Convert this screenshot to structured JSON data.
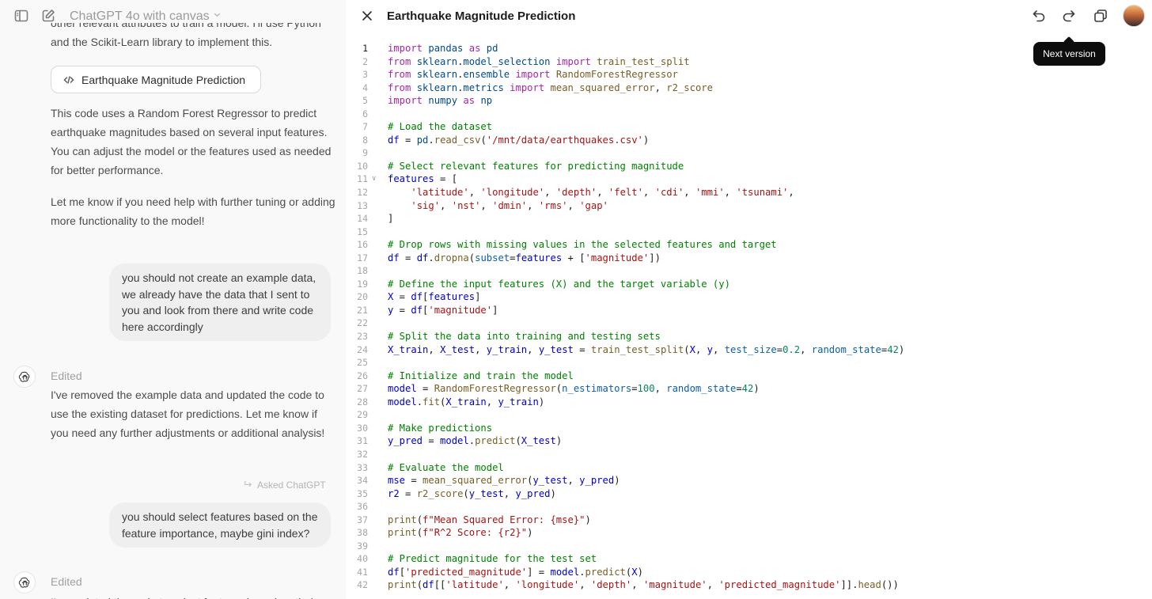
{
  "header": {
    "model_title": "ChatGPT 4o with canvas"
  },
  "chat": {
    "clipped_top_line": "other relevant attributes to train a model. I'll use Python",
    "intro_line": "and the Scikit-Learn library to implement this.",
    "canvas_chip_label": "Earthquake Magnitude Prediction",
    "assistant_msg_1": "This code uses a Random Forest Regressor to predict earthquake magnitudes based on several input features. You can adjust the model or the features used as needed for better performance.",
    "assistant_msg_2": "Let me know if you need help with further tuning or adding more functionality to the model!",
    "user_msg_1": "you should not create an example data, we already have the data that I sent to you and look from there and write code here accordingly",
    "edited_label_1": "Edited",
    "assistant_msg_3": "I've removed the example data and updated the code to use the existing dataset for predictions. Let me know if you need any further adjustments or additional analysis!",
    "asked_label": "Asked ChatGPT",
    "user_msg_2": "you should select features based on the feature importance, maybe gini index?",
    "edited_label_2": "Edited",
    "clipped_bottom_line": "I've updated the code to select features based on their"
  },
  "canvas": {
    "title": "Earthquake Magnitude Prediction",
    "tooltip": "Next version",
    "icons": {
      "close": "close-icon",
      "undo": "undo-icon",
      "redo": "redo-icon",
      "copy": "copy-icon"
    },
    "active_line": 1,
    "code_lines": [
      "import pandas as pd",
      "from sklearn.model_selection import train_test_split",
      "from sklearn.ensemble import RandomForestRegressor",
      "from sklearn.metrics import mean_squared_error, r2_score",
      "import numpy as np",
      "",
      "# Load the dataset",
      "df = pd.read_csv('/mnt/data/earthquakes.csv')",
      "",
      "# Select relevant features for predicting magnitude",
      "features = [",
      "    'latitude', 'longitude', 'depth', 'felt', 'cdi', 'mmi', 'tsunami',",
      "    'sig', 'nst', 'dmin', 'rms', 'gap'",
      "]",
      "",
      "# Drop rows with missing values in the selected features and target",
      "df = df.dropna(subset=features + ['magnitude'])",
      "",
      "# Define the input features (X) and the target variable (y)",
      "X = df[features]",
      "y = df['magnitude']",
      "",
      "# Split the data into training and testing sets",
      "X_train, X_test, y_train, y_test = train_test_split(X, y, test_size=0.2, random_state=42)",
      "",
      "# Initialize and train the model",
      "model = RandomForestRegressor(n_estimators=100, random_state=42)",
      "model.fit(X_train, y_train)",
      "",
      "# Make predictions",
      "y_pred = model.predict(X_test)",
      "",
      "# Evaluate the model",
      "mse = mean_squared_error(y_test, y_pred)",
      "r2 = r2_score(y_test, y_pred)",
      "",
      "print(f\"Mean Squared Error: {mse}\")",
      "print(f\"R^2 Score: {r2}\")",
      "",
      "# Predict magnitude for the test set",
      "df['predicted_magnitude'] = model.predict(X)",
      "print(df[['latitude', 'longitude', 'depth', 'magnitude', 'predicted_magnitude']].head())"
    ]
  }
}
